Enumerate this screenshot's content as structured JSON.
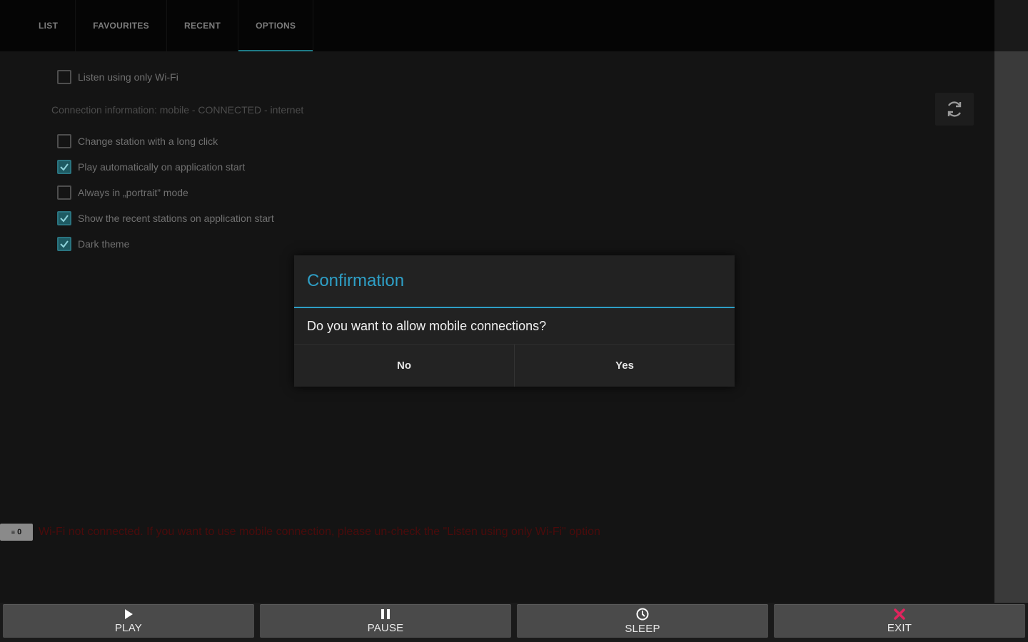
{
  "tabs": [
    {
      "label": "LIST"
    },
    {
      "label": "FAVOURITES"
    },
    {
      "label": "RECENT"
    },
    {
      "label": "OPTIONS"
    }
  ],
  "options": {
    "wifi_only": {
      "label": "Listen using only Wi-Fi",
      "checked": false
    },
    "connection_info": "Connection information: mobile - CONNECTED - internet",
    "items": [
      {
        "label": "Change station with a long click",
        "checked": false
      },
      {
        "label": "Play automatically on application start",
        "checked": true
      },
      {
        "label": "Always in „portrait” mode",
        "checked": false
      },
      {
        "label": "Show the recent stations on application start",
        "checked": true
      },
      {
        "label": "Dark theme",
        "checked": true
      }
    ]
  },
  "status": {
    "icon_label": "0",
    "message": "Wi-Fi not connected. If you want to use mobile connection, please un-check the \"Listen using only Wi-Fi\" option"
  },
  "dialog": {
    "title": "Confirmation",
    "message": "Do you want to allow mobile connections?",
    "no_label": "No",
    "yes_label": "Yes"
  },
  "bottom": {
    "play": "PLAY",
    "pause": "PAUSE",
    "sleep": "SLEEP",
    "exit": "EXIT"
  },
  "colors": {
    "accent": "#2e9fc6",
    "tab_indicator": "#1e7a86",
    "exit_icon": "#e0245e",
    "status_text": "#4a0b0b"
  }
}
